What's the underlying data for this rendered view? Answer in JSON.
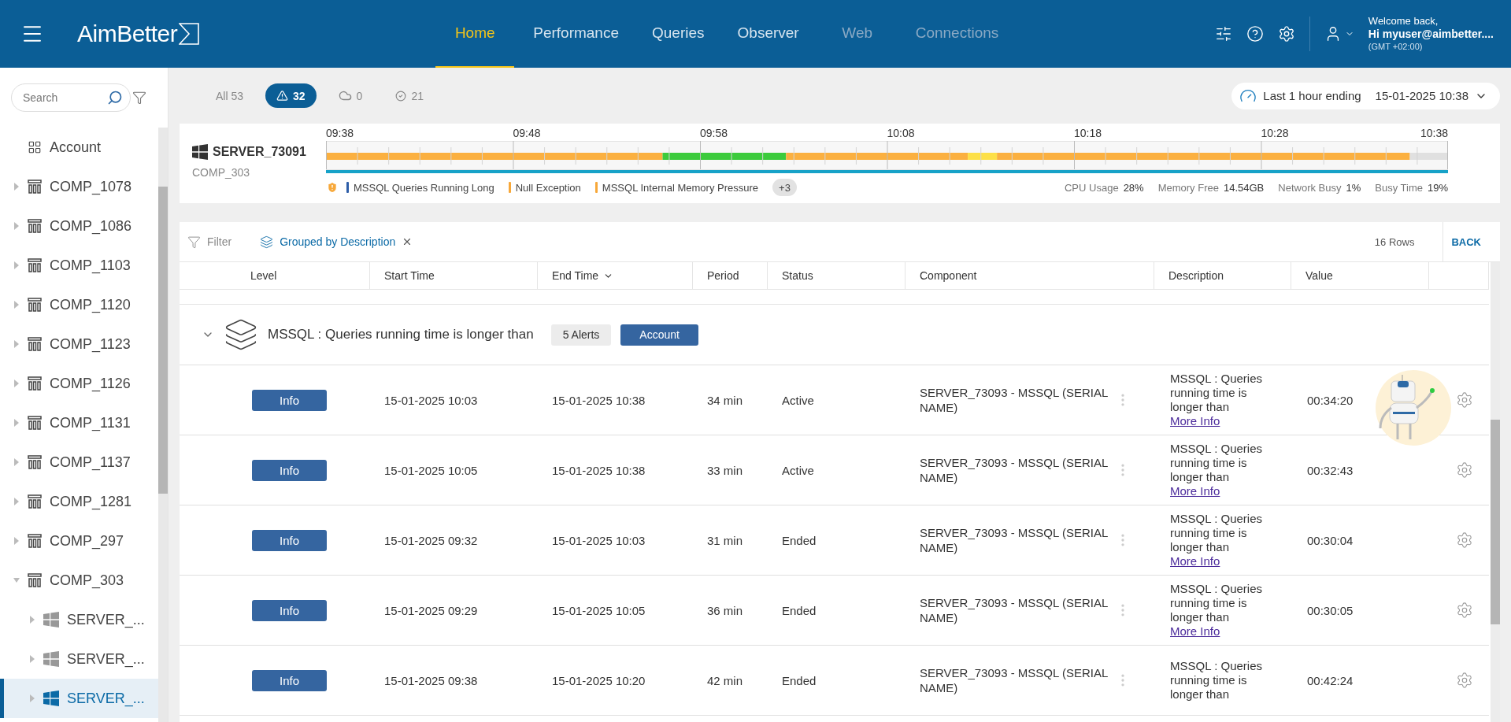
{
  "header": {
    "logo": "AimBetter",
    "nav": [
      {
        "label": "Home",
        "selected": true,
        "disabled": false
      },
      {
        "label": "Performance",
        "selected": false,
        "disabled": false
      },
      {
        "label": "Queries",
        "selected": false,
        "disabled": false
      },
      {
        "label": "Observer",
        "selected": false,
        "disabled": false
      },
      {
        "label": "Web",
        "selected": false,
        "disabled": true
      },
      {
        "label": "Connections",
        "selected": false,
        "disabled": true
      }
    ],
    "user": {
      "greeting": "Welcome back,",
      "name": "Hi myuser@aimbetter....",
      "timezone": "(GMT +02:00)"
    }
  },
  "sidebar": {
    "search": {
      "placeholder": "Search"
    },
    "tree": [
      {
        "label": "Account",
        "kind": "account",
        "selected": false
      },
      {
        "label": "COMP_1078",
        "kind": "company",
        "expanded": false,
        "selected": false
      },
      {
        "label": "COMP_1086",
        "kind": "company",
        "expanded": false,
        "selected": false
      },
      {
        "label": "COMP_1103",
        "kind": "company",
        "expanded": false,
        "selected": false
      },
      {
        "label": "COMP_1120",
        "kind": "company",
        "expanded": false,
        "selected": false
      },
      {
        "label": "COMP_1123",
        "kind": "company",
        "expanded": false,
        "selected": false
      },
      {
        "label": "COMP_1126",
        "kind": "company",
        "expanded": false,
        "selected": false
      },
      {
        "label": "COMP_1131",
        "kind": "company",
        "expanded": false,
        "selected": false
      },
      {
        "label": "COMP_1137",
        "kind": "company",
        "expanded": false,
        "selected": false
      },
      {
        "label": "COMP_1281",
        "kind": "company",
        "expanded": false,
        "selected": false
      },
      {
        "label": "COMP_297",
        "kind": "company",
        "expanded": false,
        "selected": false
      },
      {
        "label": "COMP_303",
        "kind": "company",
        "expanded": true,
        "selected": false,
        "children": [
          {
            "label": "SERVER_...",
            "kind": "server",
            "expanded": false,
            "selected": false
          },
          {
            "label": "SERVER_...",
            "kind": "server",
            "expanded": false,
            "selected": false
          },
          {
            "label": "SERVER_...",
            "kind": "server",
            "expanded": false,
            "selected": true
          }
        ]
      }
    ]
  },
  "alert_filters": [
    {
      "kind": "all",
      "label": "All",
      "count": "53",
      "selected": false
    },
    {
      "kind": "alerts",
      "count": "32",
      "selected": true
    },
    {
      "kind": "cloud",
      "count": "0",
      "selected": false
    },
    {
      "kind": "resolved",
      "count": "21",
      "selected": false
    }
  ],
  "time_range": {
    "label": "Last 1 hour ending",
    "value": "15-01-2025 10:38"
  },
  "server": {
    "name": "SERVER_73091",
    "company": "COMP_303",
    "ticks": [
      "09:38",
      "09:48",
      "09:58",
      "10:08",
      "10:18",
      "10:28",
      "10:38"
    ],
    "legend": [
      {
        "label": "MSSQL Queries Running Long",
        "color": "#2e5ea8"
      },
      {
        "label": "Null Exception",
        "color": "#f7a83a"
      },
      {
        "label": "MSSQL Internal Memory Pressure",
        "color": "#f7a83a"
      }
    ],
    "more": "+3",
    "stats": [
      {
        "label": "CPU Usage",
        "value": "28%"
      },
      {
        "label": "Memory Free",
        "value": "14.54GB"
      },
      {
        "label": "Network Busy",
        "value": "1%"
      },
      {
        "label": "Busy Time",
        "value": "19%"
      }
    ]
  },
  "table": {
    "filter_label": "Filter",
    "grouping": "Grouped by Description",
    "row_count": "16 Rows",
    "back": "BACK",
    "columns": [
      {
        "label": "Level",
        "sorted": false
      },
      {
        "label": "Start Time",
        "sorted": false
      },
      {
        "label": "End Time",
        "sorted": true
      },
      {
        "label": "Period",
        "sorted": false
      },
      {
        "label": "Status",
        "sorted": false
      },
      {
        "label": "Component",
        "sorted": false
      },
      {
        "label": "Description",
        "sorted": false
      },
      {
        "label": "Value",
        "sorted": false
      }
    ],
    "group": {
      "expanded": true,
      "title": "MSSQL : Queries running time is longer than",
      "alerts": "5 Alerts",
      "tag": "Account"
    },
    "rows": [
      {
        "level": "Info",
        "start": "15-01-2025 10:03",
        "end": "15-01-2025 10:38",
        "period": "34 min",
        "status": "Active",
        "component": "SERVER_73093 - MSSQL (SERIAL NAME)",
        "description": "MSSQL : Queries running time is longer than",
        "link": "More Info",
        "value": "00:34:20"
      },
      {
        "level": "Info",
        "start": "15-01-2025 10:05",
        "end": "15-01-2025 10:38",
        "period": "33 min",
        "status": "Active",
        "component": "SERVER_73093 - MSSQL (SERIAL NAME)",
        "description": "MSSQL : Queries running time is longer than",
        "link": "More Info",
        "value": "00:32:43"
      },
      {
        "level": "Info",
        "start": "15-01-2025 09:32",
        "end": "15-01-2025 10:03",
        "period": "31 min",
        "status": "Ended",
        "component": "SERVER_73093 - MSSQL (SERIAL NAME)",
        "description": "MSSQL : Queries running time is longer than",
        "link": "More Info",
        "value": "00:30:04"
      },
      {
        "level": "Info",
        "start": "15-01-2025 09:29",
        "end": "15-01-2025 10:05",
        "period": "36 min",
        "status": "Ended",
        "component": "SERVER_73093 - MSSQL (SERIAL NAME)",
        "description": "MSSQL : Queries running time is longer than",
        "link": "More Info",
        "value": "00:30:05"
      },
      {
        "level": "Info",
        "start": "15-01-2025 09:38",
        "end": "15-01-2025 10:20",
        "period": "42 min",
        "status": "Ended",
        "component": "SERVER_73093 - MSSQL (SERIAL NAME)",
        "description": "MSSQL : Queries running time is longer than",
        "value": "00:42:24"
      }
    ]
  }
}
